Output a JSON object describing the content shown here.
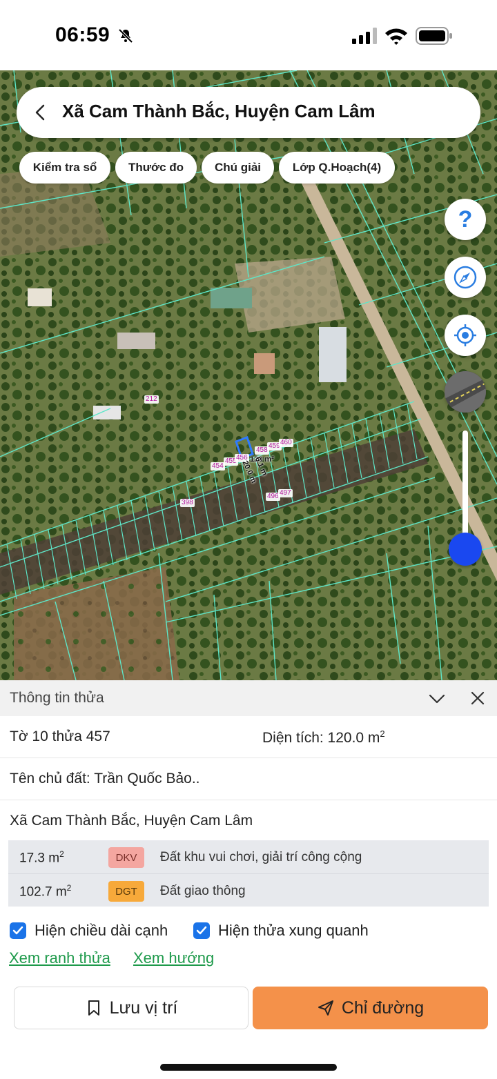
{
  "status_bar": {
    "time": "06:59"
  },
  "search": {
    "title": "Xã Cam Thành Bắc, Huyện Cam Lâm"
  },
  "chips": [
    "Kiểm tra sổ",
    "Thước đo",
    "Chú giải",
    "Lớp Q.Hoạch(4)"
  ],
  "map": {
    "parcel_labels": [
      "212",
      "454",
      "455",
      "456",
      "458",
      "459",
      "460",
      "398",
      "496",
      "497"
    ],
    "measures": [
      "120 m²",
      "20.0 m",
      "6.1 m"
    ],
    "colors": {
      "boundary": "#5ee6c8",
      "selected": "#2f7bff",
      "parcel_number": "#b3179d"
    }
  },
  "panel": {
    "title": "Thông tin thửa",
    "sheet_parcel": "Tờ 10 thửa 457",
    "area_label": "Diện tích: 120.0 m",
    "area_sup": "2",
    "owner": "Tên chủ đất: Trần Quốc Bảo..",
    "address": "Xã Cam Thành Bắc, Huyện Cam Lâm",
    "landuse": [
      {
        "area": "17.3 m",
        "sup": "2",
        "code": "DKV",
        "code_color": "#f4a6a0",
        "desc": "Đất khu vui chơi, giải trí công cộng"
      },
      {
        "area": "102.7 m",
        "sup": "2",
        "code": "DGT",
        "code_color": "#f7a93a",
        "desc": "Đất giao thông"
      }
    ],
    "checks": {
      "edge_length": "Hiện chiều dài cạnh",
      "surrounding": "Hiện thửa xung quanh"
    },
    "links": {
      "boundary": "Xem ranh thửa",
      "direction": "Xem hướng"
    },
    "buttons": {
      "save": "Lưu vị trí",
      "directions": "Chỉ đường"
    }
  }
}
